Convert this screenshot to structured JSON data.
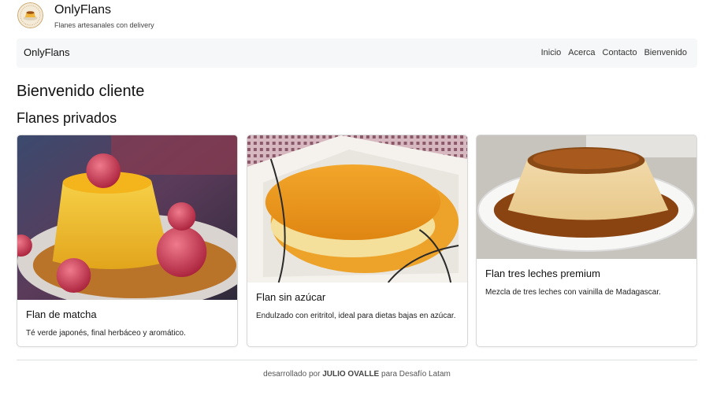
{
  "header": {
    "brand_title": "OnlyFlans",
    "brand_subtitle": "Flanes artesanales con delivery"
  },
  "navbar": {
    "brand": "OnlyFlans",
    "links": [
      "Inicio",
      "Acerca",
      "Contacto",
      "Bienvenido"
    ]
  },
  "main": {
    "heading": "Bienvenido cliente",
    "subheading": "Flanes privados",
    "cards": [
      {
        "title": "Flan de matcha",
        "text": "Té verde japonés, final herbáceo y aromático."
      },
      {
        "title": "Flan sin azúcar",
        "text": "Endulzado con eritritol, ideal para dietas bajas en azúcar."
      },
      {
        "title": "Flan tres leches premium",
        "text": "Mezcla de tres leches con vainilla de Madagascar."
      }
    ]
  },
  "footer": {
    "prefix": "desarrollado por",
    "author": "JULIO OVALLE",
    "suffix": "para Desafío Latam"
  },
  "colors": {
    "navbar_bg": "#f6f7f8",
    "text": "#212529",
    "caramel": "#c8791c",
    "custard": "#f2c84b"
  }
}
